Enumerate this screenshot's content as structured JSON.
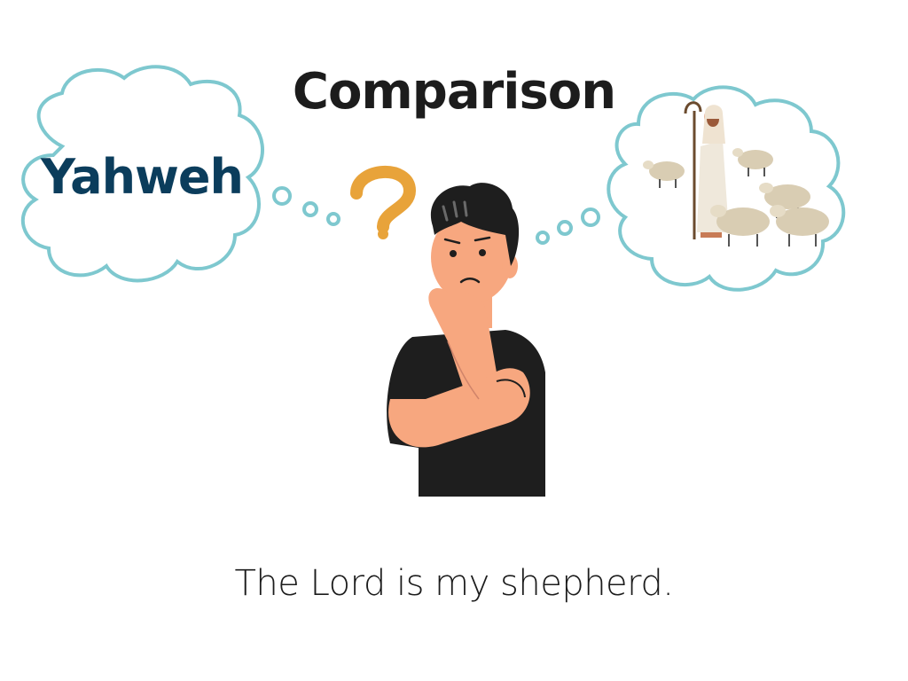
{
  "slide": {
    "title": "Comparison",
    "left_thought": "Yahweh",
    "caption": "The Lord is my shepherd."
  },
  "icons": {
    "left_cloud": "thought-cloud-icon",
    "right_cloud": "thought-cloud-icon",
    "question": "question-mark-icon",
    "person": "thinking-man-icon",
    "shepherd": "shepherd-icon",
    "sheep": "sheep-icon"
  },
  "colors": {
    "cloud_outline": "#7ec8cf",
    "title_text": "#1c1c1c",
    "yahweh_text": "#0b3d5c",
    "question_mark": "#e8a33a",
    "skin": "#f7a77f",
    "shirt": "#1e1e1e",
    "hair": "#1e1e1e",
    "sheep_wool": "#d9cdb3"
  }
}
